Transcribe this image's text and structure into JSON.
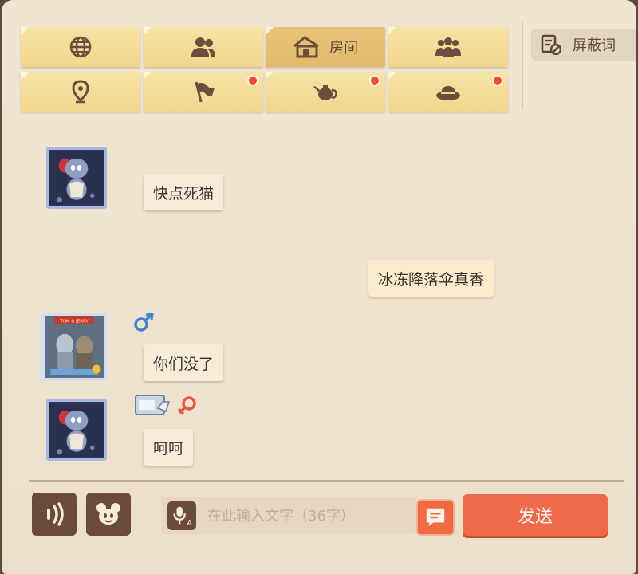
{
  "tabs": [
    {
      "icon": "globe-icon",
      "label": "",
      "active": false,
      "notify": false
    },
    {
      "icon": "friends-icon",
      "label": "",
      "active": false,
      "notify": false
    },
    {
      "icon": "house-icon",
      "label": "房间",
      "active": true,
      "notify": false
    },
    {
      "icon": "team-icon",
      "label": "",
      "active": false,
      "notify": false
    },
    {
      "icon": "location-pin-icon",
      "label": "",
      "active": false,
      "notify": false
    },
    {
      "icon": "flag-icon",
      "label": "",
      "active": false,
      "notify": true
    },
    {
      "icon": "teapot-icon",
      "label": "",
      "active": false,
      "notify": true
    },
    {
      "icon": "hat-icon",
      "label": "",
      "active": false,
      "notify": true
    }
  ],
  "filter_button": {
    "label": "屏蔽词",
    "icon": "block-list-icon"
  },
  "messages": [
    {
      "side": "left",
      "avatar": "mouse-avatar",
      "text": "快点死猫",
      "gender": "",
      "extra_badge": ""
    },
    {
      "side": "right",
      "avatar": "",
      "text": "冰冻降落伞真香",
      "gender": "",
      "extra_badge": ""
    },
    {
      "side": "left",
      "avatar": "ultraman-avatar",
      "text": "你们没了",
      "gender": "male",
      "extra_badge": ""
    },
    {
      "side": "left",
      "avatar": "mouse-avatar",
      "text": "呵呵",
      "gender": "female",
      "extra_badge": "diamond-card"
    }
  ],
  "avatar_frame_text": "TOM & JERRY",
  "composer": {
    "placeholder": "在此输入文字（36字）",
    "send_label": "发送"
  },
  "colors": {
    "tab": "#f1d68d",
    "tab_active": "#e3b96c",
    "send": "#ef6a4a",
    "notify": "#ee4a3a",
    "male": "#3f86cf",
    "female": "#e45a45"
  }
}
